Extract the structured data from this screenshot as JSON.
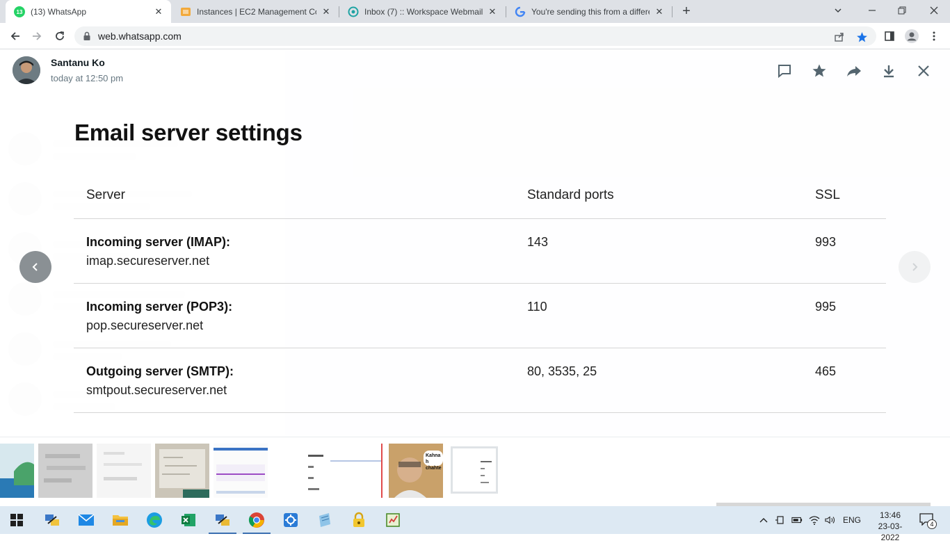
{
  "browser": {
    "tabs": [
      {
        "title": "(13) WhatsApp",
        "badge": "13",
        "favicon": "whatsapp-icon",
        "active": true
      },
      {
        "title": "Instances | EC2 Management Con",
        "favicon": "aws-icon",
        "active": false
      },
      {
        "title": "Inbox (7) :: Workspace Webmail",
        "favicon": "webmail-icon",
        "active": false
      },
      {
        "title": "You're sending this from a differe",
        "favicon": "google-icon",
        "active": false
      }
    ],
    "url": "web.whatsapp.com"
  },
  "viewer": {
    "sender_name": "Santanu Ko",
    "sent_time": "today at 12:50 pm",
    "actions": [
      "chat-icon",
      "star-icon",
      "forward-icon",
      "download-icon",
      "close-icon"
    ]
  },
  "document": {
    "title": "Email server settings",
    "columns": [
      "Server",
      "Standard ports",
      "SSL"
    ],
    "rows": [
      {
        "label": "Incoming server (IMAP):",
        "host": "imap.secureserver.net",
        "ports": "143",
        "ssl": "993"
      },
      {
        "label": "Incoming server (POP3):",
        "host": "pop.secureserver.net",
        "ports": "110",
        "ssl": "995"
      },
      {
        "label": "Outgoing server (SMTP):",
        "host": "smtpout.secureserver.net",
        "ports": "80, 3535, 25",
        "ssl": "465"
      }
    ]
  },
  "thumbnails": {
    "kahna_caption": "Kahna h chahte"
  },
  "taskbar": {
    "language": "ENG",
    "time": "13:46",
    "date": "23-03-2022",
    "notifications": "4"
  },
  "colors": {
    "whatsapp_green": "#25d366",
    "chrome_blue": "#1a73e8",
    "taskbar_bg": "#dde9f3"
  }
}
